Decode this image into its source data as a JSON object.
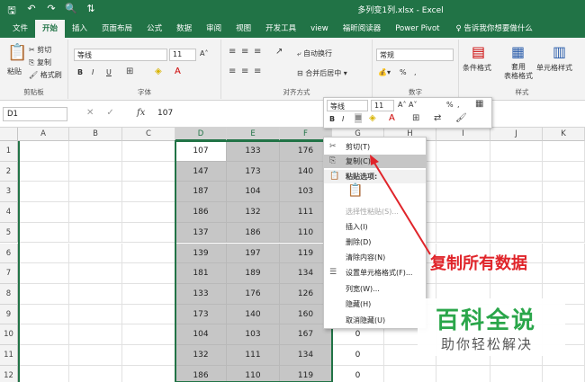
{
  "window": {
    "title": "多列变1列.xlsx - Excel"
  },
  "qat": {
    "save": "🖫",
    "undo": "↶",
    "redo": "↷",
    "preview": "🔍",
    "sort": "⇅"
  },
  "tabs": [
    "文件",
    "开始",
    "插入",
    "页面布局",
    "公式",
    "数据",
    "审阅",
    "视图",
    "开发工具",
    "view",
    "福昕阅读器",
    "Power Pivot"
  ],
  "active_tab": "开始",
  "tell_me": "♀ 告诉我你想要做什么",
  "ribbon": {
    "clipboard": {
      "paste": "粘贴",
      "cut": "剪切",
      "copy": "复制",
      "format_painter": "格式刷",
      "label": "剪贴板"
    },
    "font": {
      "name": "等线",
      "size": "11",
      "grow": "A˄",
      "shrink": "A˅",
      "bold": "B",
      "italic": "I",
      "underline": "U",
      "label": "字体"
    },
    "alignment": {
      "wrap": "自动换行",
      "merge": "合并后居中",
      "label": "对齐方式"
    },
    "number": {
      "format": "常规",
      "percent": "%",
      "comma": ",",
      "label": "数字"
    },
    "styles": {
      "conditional": "条件格式",
      "table": "套用\n表格格式",
      "cell": "单元格样式",
      "label": "样式"
    }
  },
  "formula_bar": {
    "name_box": "D1",
    "fx": "fx",
    "value": "107"
  },
  "columns": [
    "A",
    "B",
    "C",
    "D",
    "E",
    "F",
    "G",
    "H",
    "I",
    "J",
    "K"
  ],
  "rows": [
    "1",
    "2",
    "3",
    "4",
    "5",
    "6",
    "7",
    "8",
    "9",
    "10",
    "11",
    "12"
  ],
  "sheet_values": {
    "D": [
      107,
      147,
      187,
      186,
      137,
      139,
      181,
      133,
      173,
      104,
      132,
      186
    ],
    "E": [
      133,
      173,
      104,
      132,
      186,
      197,
      189,
      176,
      140,
      103,
      111,
      110
    ],
    "F": [
      176,
      140,
      103,
      111,
      110,
      119,
      134,
      126,
      160,
      167,
      134,
      119
    ],
    "G": [
      "",
      "",
      "",
      "",
      "",
      "",
      "",
      "",
      "",
      0,
      0,
      0
    ]
  },
  "mini_toolbar": {
    "font": "等线",
    "size": "11",
    "bold": "B",
    "italic": "I",
    "percent": "%",
    "comma": ","
  },
  "context_menu": [
    {
      "label": "剪切(T)",
      "icon": "✂"
    },
    {
      "label": "复制(C)",
      "icon": "⎘",
      "highlight": true
    },
    {
      "label": "粘贴选项:",
      "icon": "📋",
      "header": true
    },
    {
      "label": "",
      "icon": "📋"
    },
    {
      "label": "选择性粘贴(S)...",
      "disabled": true
    },
    {
      "label": "插入(I)"
    },
    {
      "label": "删除(D)"
    },
    {
      "label": "清除内容(N)"
    },
    {
      "label": "设置单元格格式(F)...",
      "icon": "☰"
    },
    {
      "label": "列宽(W)..."
    },
    {
      "label": "隐藏(H)"
    },
    {
      "label": "取消隐藏(U)"
    }
  ],
  "annotation": {
    "text": "复制所有数据",
    "color": "#e0242a"
  },
  "watermark": {
    "line1": "百科全说",
    "line2": "助你轻松解决",
    "color": "#2aa64a"
  },
  "colors": {
    "accent": "#217346",
    "selection": "#c6c6c6"
  }
}
